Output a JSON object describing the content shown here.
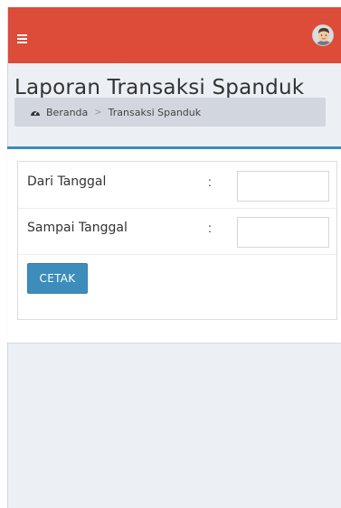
{
  "header": {
    "menu_icon": "hamburger-icon",
    "avatar_icon": "user-avatar-icon",
    "brand_color": "#dd4b39"
  },
  "page": {
    "title": "Laporan Transaksi Spanduk"
  },
  "breadcrumb": {
    "home_icon": "dashboard-icon",
    "home_label": "Beranda",
    "separator": ">",
    "current_label": "Transaksi Spanduk"
  },
  "form": {
    "accent_color": "#3c8dbc",
    "fields": [
      {
        "label": "Dari Tanggal",
        "colon": ":",
        "value": ""
      },
      {
        "label": "Sampai Tanggal",
        "colon": ":",
        "value": ""
      }
    ],
    "submit_label": "CETAK"
  }
}
